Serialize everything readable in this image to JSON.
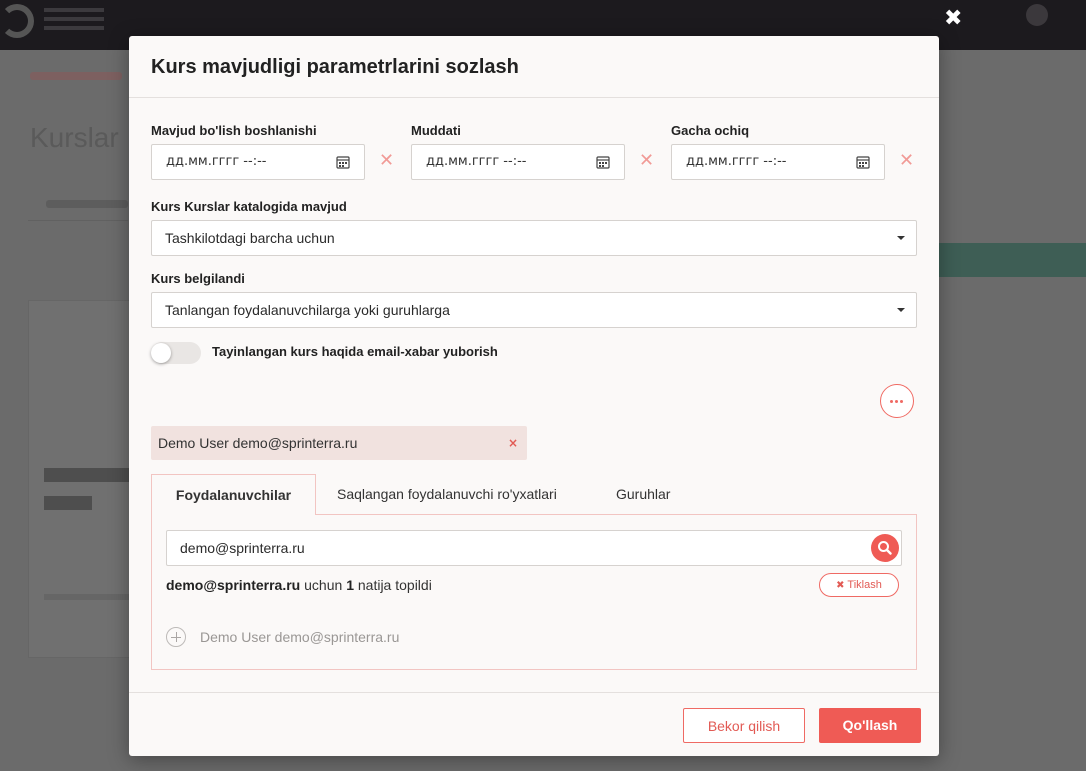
{
  "modal": {
    "title": "Kurs mavjudligi parametrlarini sozlash",
    "close_icon": "close-icon",
    "dates": [
      {
        "label": "Mavjud bo'lish boshlanishi",
        "placeholder": "дд.мм.гггг --:--"
      },
      {
        "label": "Muddati",
        "placeholder": "дд.мм.гггг --:--"
      },
      {
        "label": "Gacha ochiq",
        "placeholder": "дд.мм.гггг --:--"
      }
    ],
    "catalog": {
      "label": "Kurs Kurslar katalogida mavjud",
      "value": "Tashkilotdagi barcha uchun"
    },
    "assigned": {
      "label": "Kurs belgilandi",
      "value": "Tanlangan foydalanuvchilarga yoki guruhlarga"
    },
    "email_toggle": {
      "label": "Tayinlangan kurs haqida email-xabar yuborish",
      "on": false
    },
    "selected_chip": {
      "text": "Demo User demo@sprinterra.ru",
      "remove": "×"
    },
    "tabs": [
      "Foydalanuvchilar",
      "Saqlangan foydalanuvchi ro'yxatlari",
      "Guruhlar"
    ],
    "active_tab": 0,
    "search": {
      "value": "demo@sprinterra.ru"
    },
    "result": {
      "query": "demo@sprinterra.ru",
      "for_text": "uchun",
      "count": "1",
      "found_text": "natija topildi"
    },
    "reset_button": "Tiklash",
    "reset_icon": "✖",
    "user_result": "Demo User demo@sprinterra.ru",
    "footer": {
      "cancel": "Bekor qilish",
      "apply": "Qo'llash"
    }
  },
  "colors": {
    "accent": "#ef5b55",
    "chip_bg": "#f1e2df",
    "tab_border": "#f2c5c2"
  }
}
